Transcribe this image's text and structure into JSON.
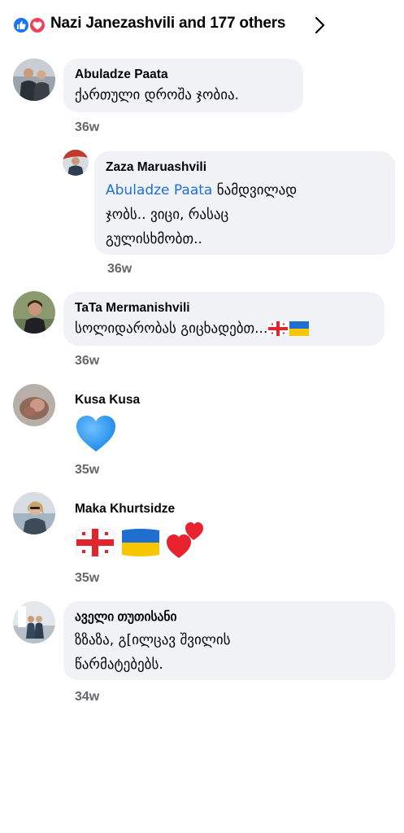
{
  "reactions": {
    "summary": "Nazi Janezashvili and 177 others",
    "icons": [
      "like-icon",
      "love-icon"
    ],
    "like_color": "#1877f2",
    "love_color": "#f33e58"
  },
  "comments": [
    {
      "author": "Abuladze Paata",
      "text": "ქართული დროშა ჯობია.",
      "time": "36w"
    },
    {
      "author": "Zaza Maruashvili",
      "mention": "Abuladze Paata",
      "text_line1": " ნამდვილად",
      "text_line2": "ჯობს.. ვიცი, რასაც",
      "text_line3": "გულისხმობთ..",
      "time": "36w"
    },
    {
      "author": "TaTa Mermanishvili",
      "text": "სოლიდარობას გიცხადებთ...",
      "time": "36w"
    },
    {
      "author": "Kusa Kusa",
      "emoji": "blue-heart",
      "time": "35w"
    },
    {
      "author": "Maka Khurtsidze",
      "emojis": [
        "georgia-flag",
        "ukraine-flag",
        "two-hearts"
      ],
      "time": "35w"
    },
    {
      "author": "აველი თუთისანი",
      "text_line1": "ზზაზა, გ[ილცავ შვილის",
      "text_line2": "წარმატებებს.",
      "time": "34w"
    }
  ],
  "colors": {
    "bubble": "#f0f2f5",
    "mention": "#216fdb",
    "time": "#65676b"
  }
}
